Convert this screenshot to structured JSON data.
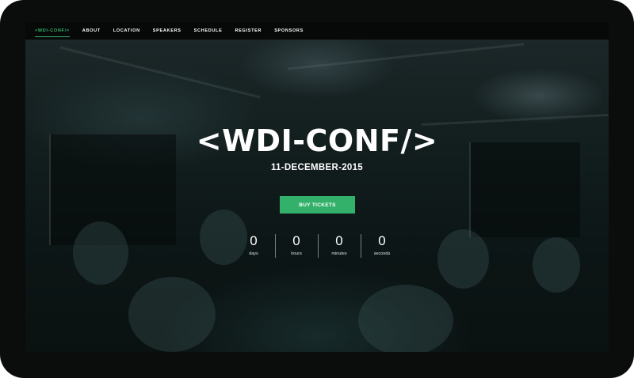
{
  "nav": {
    "items": [
      {
        "label": "<WDI-CONF/>",
        "active": true
      },
      {
        "label": "ABOUT"
      },
      {
        "label": "LOCATION"
      },
      {
        "label": "SPEAKERS"
      },
      {
        "label": "SCHEDULE"
      },
      {
        "label": "REGISTER"
      },
      {
        "label": "SPONSORS"
      }
    ]
  },
  "hero": {
    "title": "<WDI-CONF/>",
    "date": "11-DECEMBER-2015",
    "cta_label": "BUY TICKETS"
  },
  "countdown": [
    {
      "value": "0",
      "label": "days"
    },
    {
      "value": "0",
      "label": "hours"
    },
    {
      "value": "0",
      "label": "minutes"
    },
    {
      "value": "0",
      "label": "seconds"
    }
  ],
  "colors": {
    "accent": "#34b36b",
    "nav_bg": "#070808",
    "device_frame": "#0b0c0c"
  }
}
